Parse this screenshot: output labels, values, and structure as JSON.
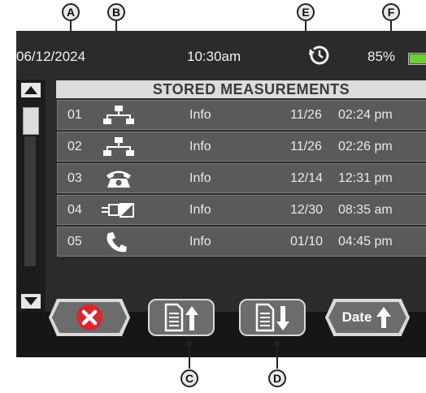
{
  "callouts": {
    "a": "A",
    "b": "B",
    "c": "C",
    "d": "D",
    "e": "E",
    "f": "F"
  },
  "status": {
    "date": "06/12/2024",
    "time": "10:30am",
    "history_icon": "history-clock-icon",
    "battery_percent": "85%",
    "battery_level": 0.85,
    "battery_color": "#6fcf2f"
  },
  "list": {
    "title": "STORED MEASUREMENTS",
    "rows": [
      {
        "num": "01",
        "type_icon": "network-icon",
        "info": "Info",
        "date": "11/26",
        "time": "02:24 pm"
      },
      {
        "num": "02",
        "type_icon": "network-icon",
        "info": "Info",
        "date": "11/26",
        "time": "02:26 pm"
      },
      {
        "num": "03",
        "type_icon": "telephone-icon",
        "info": "Info",
        "date": "12/14",
        "time": "12:31 pm"
      },
      {
        "num": "04",
        "type_icon": "line-connection-icon",
        "info": "Info",
        "date": "12/30",
        "time": "08:35 am"
      },
      {
        "num": "05",
        "type_icon": "phone-handset-icon",
        "info": "Info",
        "date": "01/10",
        "time": "04:45 pm"
      }
    ]
  },
  "buttons": {
    "close": {
      "icon": "close-icon",
      "color": "#d9272e"
    },
    "sort_up": {
      "icon": "document-arrow-up-icon"
    },
    "sort_down": {
      "icon": "document-arrow-down-icon"
    },
    "date_sort": {
      "label": "Date",
      "icon": "arrow-up-icon"
    }
  }
}
